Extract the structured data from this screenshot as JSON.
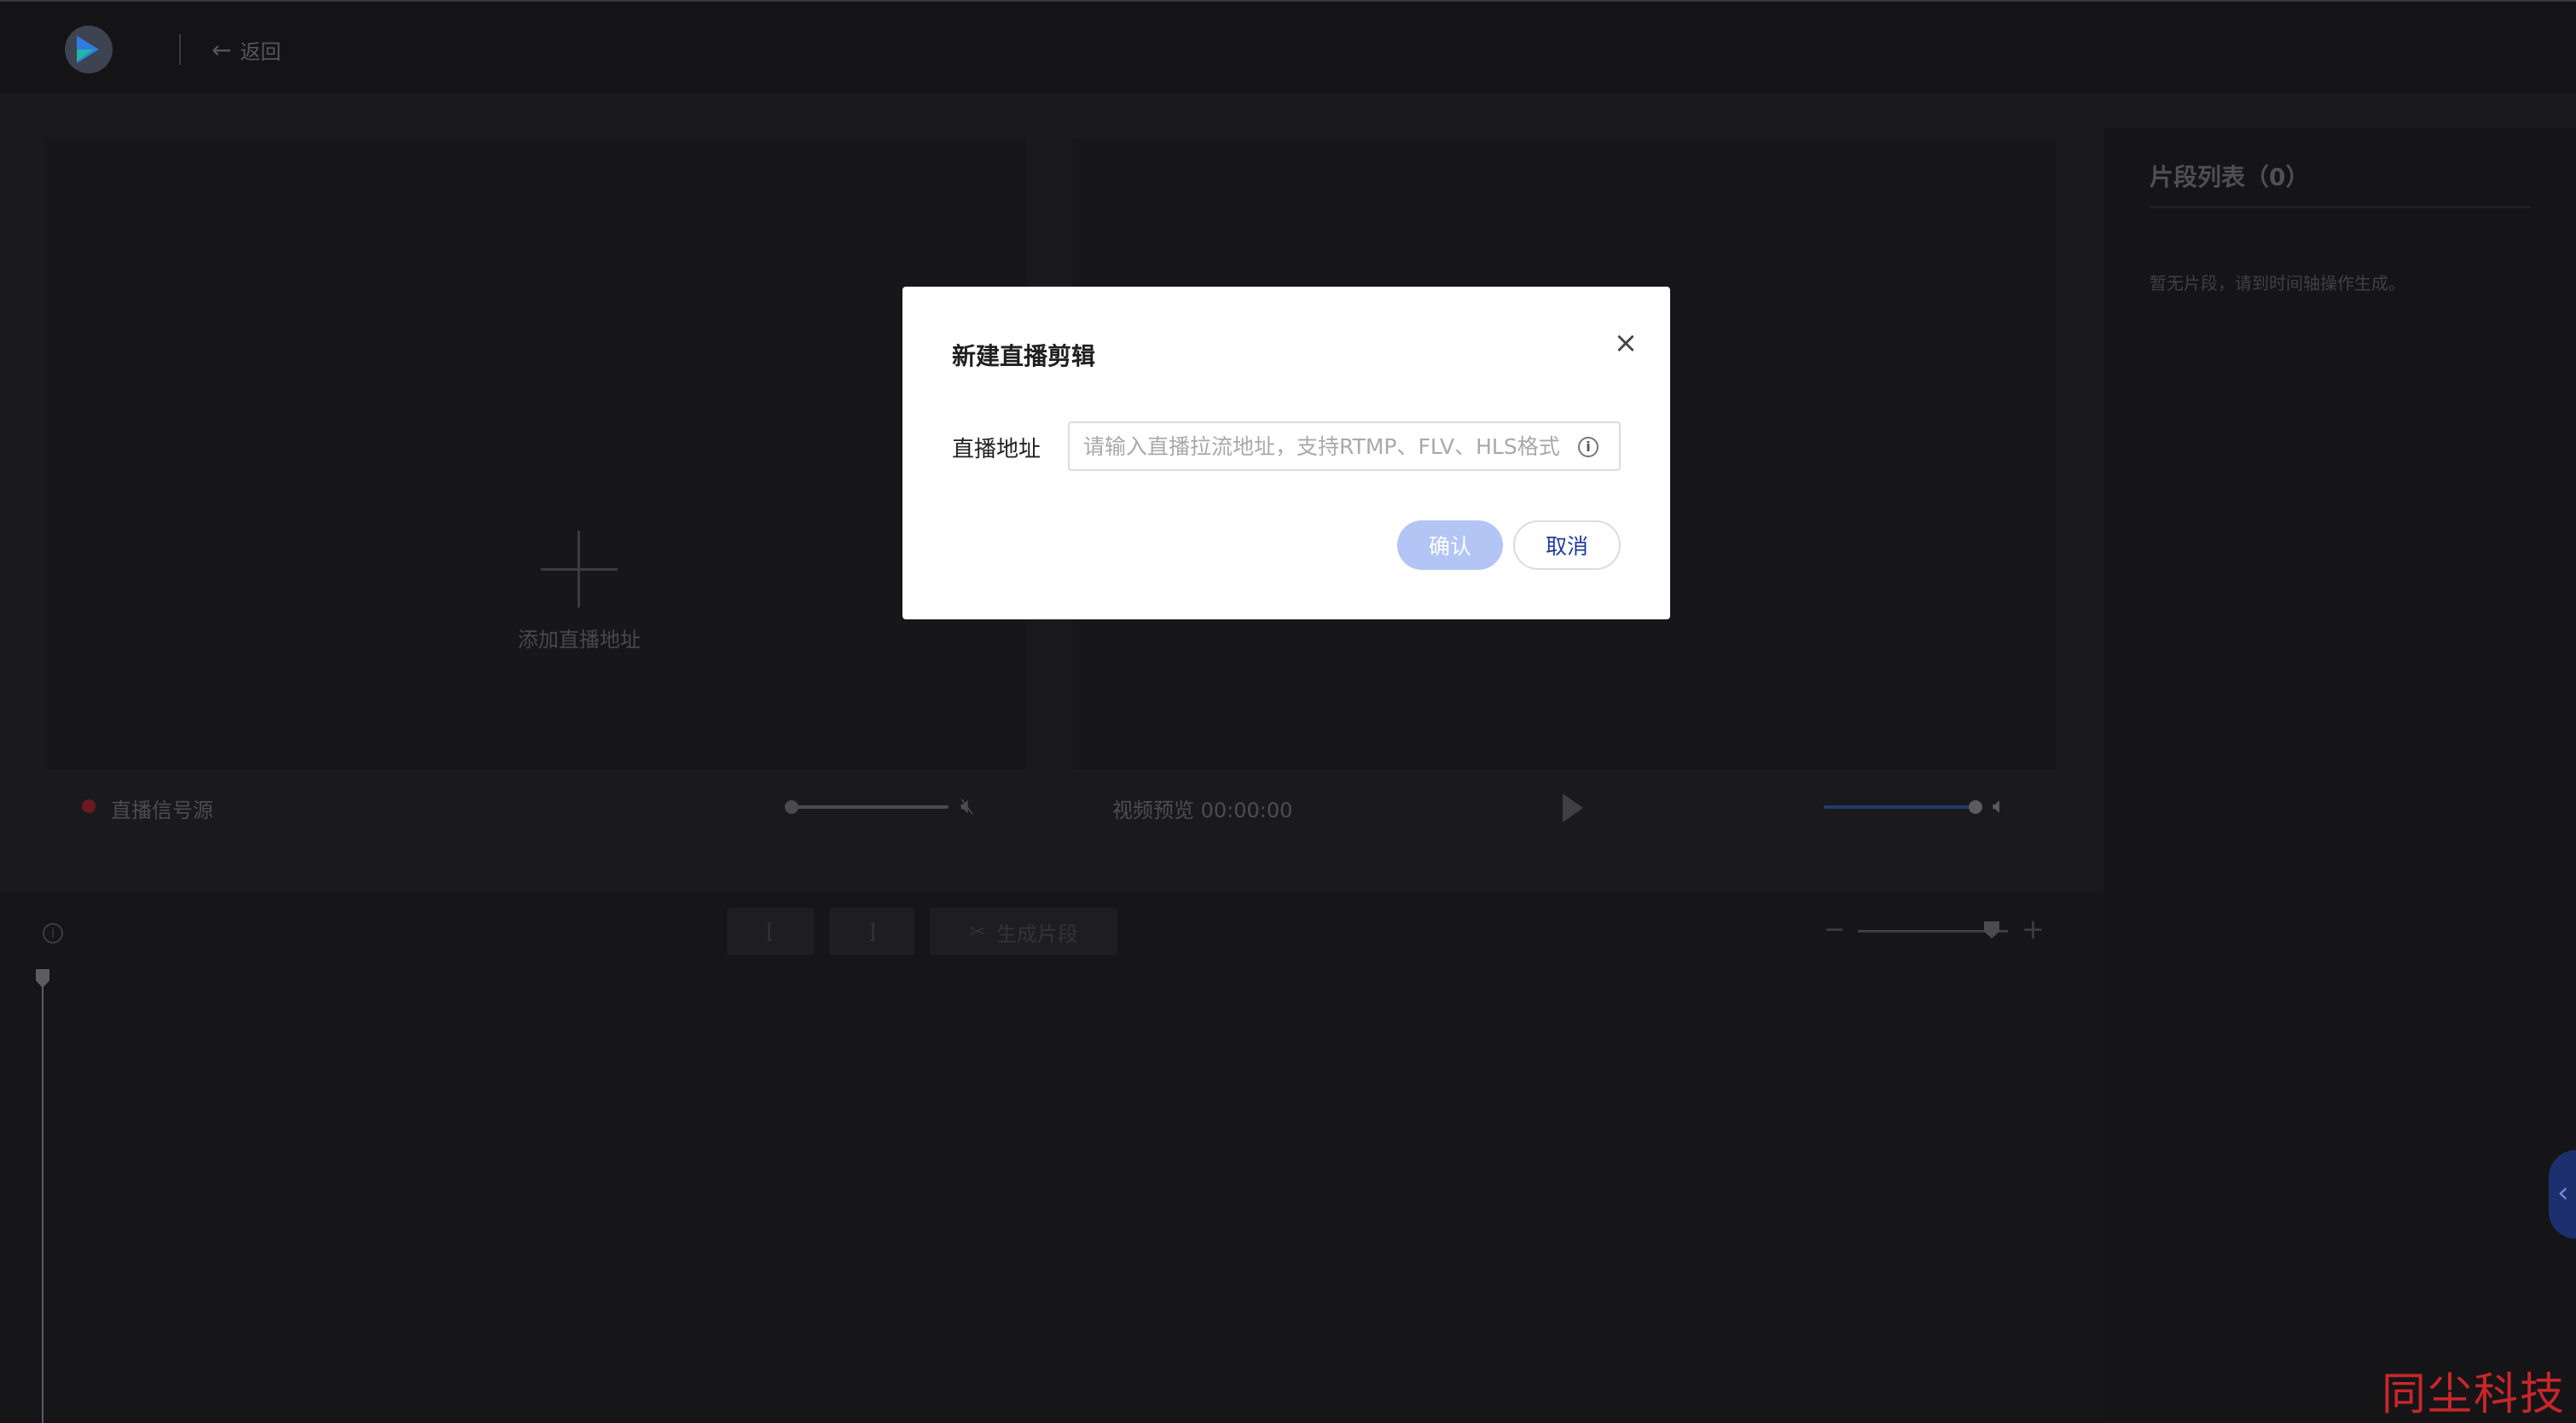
{
  "topbar": {
    "back_label": "返回"
  },
  "live_panel": {
    "add_label": "添加直播地址",
    "signal_label": "直播信号源"
  },
  "preview_panel": {
    "label": "视频预览 00:00:00"
  },
  "clip_list": {
    "title": "片段列表（0）",
    "empty_text": "暂无片段，请到时间轴操作生成。"
  },
  "timeline": {
    "generate_label": "生成片段",
    "zoom_level": 0.85
  },
  "modal": {
    "title": "新建直播剪辑",
    "field_label": "直播地址",
    "field_placeholder": "请输入直播拉流地址，支持RTMP、FLV、HLS格式",
    "field_value": "",
    "confirm_label": "确认",
    "cancel_label": "取消"
  },
  "watermark": "同尘科技",
  "colors": {
    "accent": "#1f3d9b",
    "confirm_disabled": "#b3c5f5",
    "record_dot": "#6b1b20",
    "watermark": "#c8262b"
  }
}
